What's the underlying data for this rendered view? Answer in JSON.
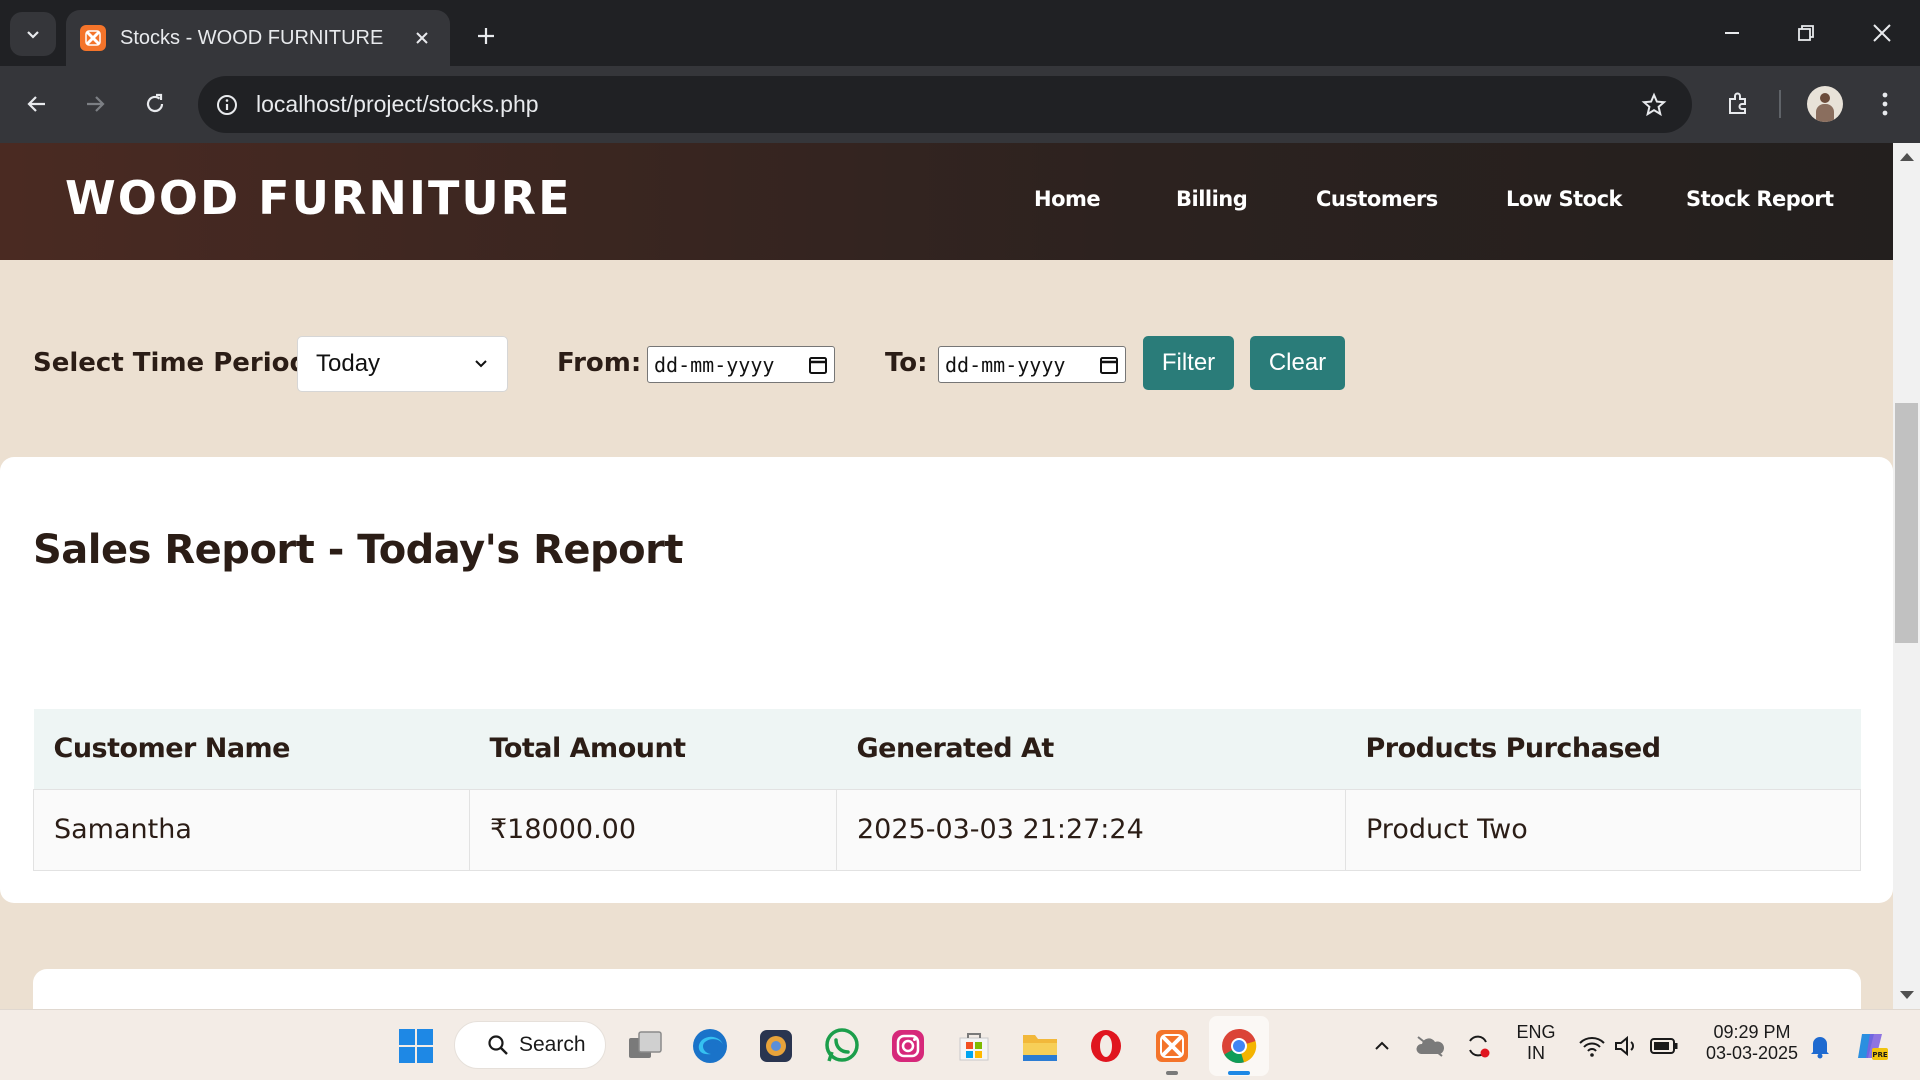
{
  "browser": {
    "tab_title": "Stocks - WOOD FURNITURE",
    "url": "localhost/project/stocks.php"
  },
  "site": {
    "brand": "WOOD FURNITURE",
    "nav": [
      "Home",
      "Billing",
      "Customers",
      "Low Stock",
      "Stock Report"
    ]
  },
  "filter": {
    "period_label": "Select Time Period:",
    "period_value": "Today",
    "from_label": "From:",
    "from_placeholder": "dd-mm-yyyy",
    "to_label": "To:",
    "to_placeholder": "dd-mm-yyyy",
    "filter_button": "Filter",
    "clear_button": "Clear"
  },
  "report": {
    "title": "Sales Report - Today's Report",
    "columns": [
      "Customer Name",
      "Total Amount",
      "Generated At",
      "Products Purchased"
    ],
    "rows": [
      [
        "Samantha",
        "₹18000.00",
        "2025-03-03 21:27:24",
        "Product Two"
      ]
    ]
  },
  "taskbar": {
    "search_label": "Search",
    "language": "ENG",
    "region": "IN",
    "time": "09:29 PM",
    "date": "03-03-2025",
    "copilot_badge": "PRE"
  },
  "colors": {
    "accent": "#2a7c79",
    "page_bg": "#ece0d1",
    "header_bg": "#3a2520"
  }
}
